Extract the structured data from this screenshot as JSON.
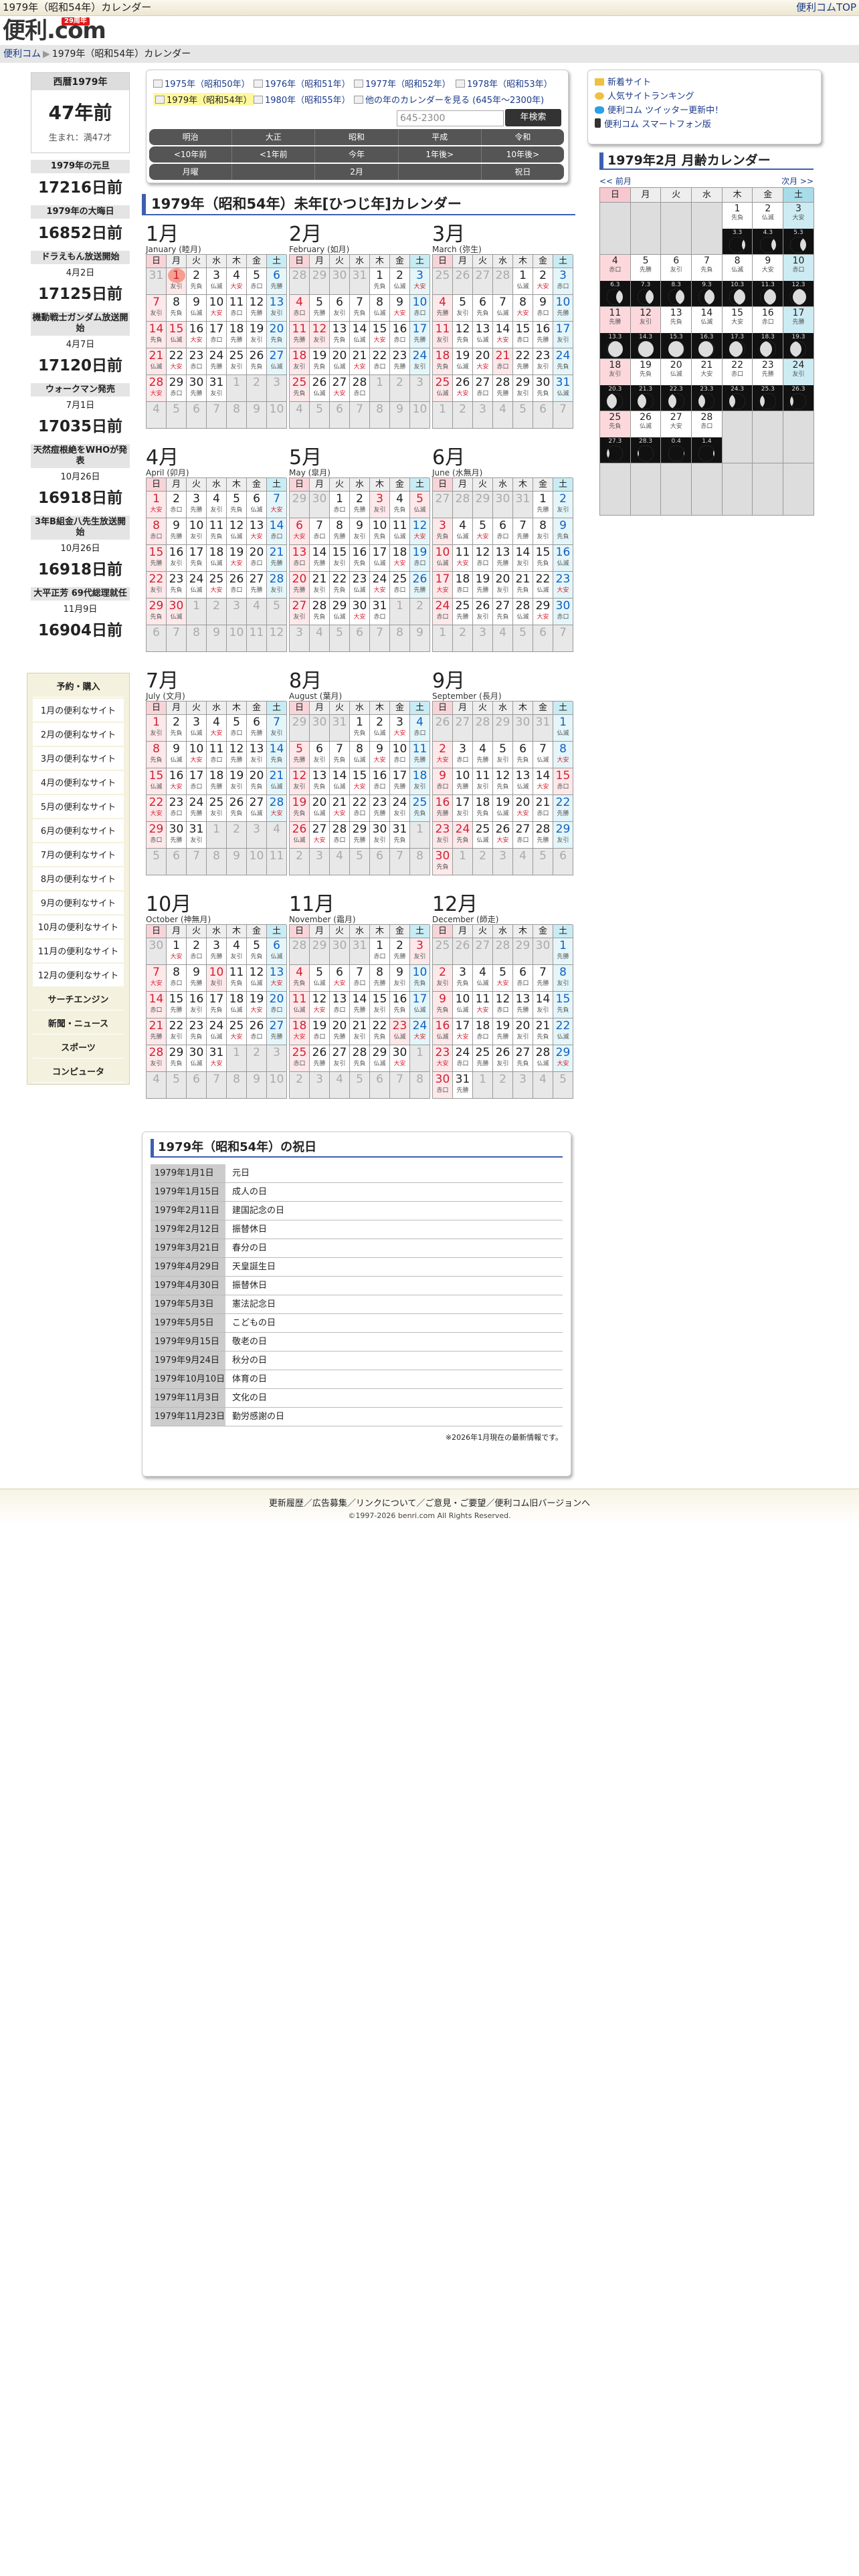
{
  "topbar": {
    "title": "1979年（昭和54年）カレンダー",
    "top_link": "便利コムTOP"
  },
  "logo": {
    "text": "便利.com",
    "badge": "29周年"
  },
  "breadcrumb": {
    "home": "便利コム",
    "sep": "▶",
    "current": "1979年（昭和54年）カレンダー"
  },
  "age": {
    "header": "西暦1979年",
    "big": "47年前",
    "small": "生まれ：満47才"
  },
  "events": [
    {
      "label": "1979年の元旦",
      "date": "",
      "num": "17216日前"
    },
    {
      "label": "1979年の大晦日",
      "date": "",
      "num": "16852日前"
    },
    {
      "label": "ドラえもん放送開始",
      "date": "4月2日",
      "num": "17125日前"
    },
    {
      "label": "機動戦士ガンダム放送開始",
      "date": "4月7日",
      "num": "17120日前"
    },
    {
      "label": "ウォークマン発売",
      "date": "7月1日",
      "num": "17035日前"
    },
    {
      "label": "天然痘根絶をWHOが発表",
      "date": "10月26日",
      "num": "16918日前"
    },
    {
      "label": "3年B組金八先生放送開始",
      "date": "10月26日",
      "num": "16918日前"
    },
    {
      "label": "大平正芳 69代総理就任",
      "date": "11月9日",
      "num": "16904日前"
    }
  ],
  "sidemenu": [
    "予約・購入",
    "1月の便利なサイト",
    "2月の便利なサイト",
    "3月の便利なサイト",
    "4月の便利なサイト",
    "5月の便利なサイト",
    "6月の便利なサイト",
    "7月の便利なサイト",
    "8月の便利なサイト",
    "9月の便利なサイト",
    "10月の便利なサイト",
    "11月の便利なサイト",
    "12月の便利なサイト",
    "サーチエンジン",
    "新聞・ニュース",
    "スポーツ",
    "コンピュータ"
  ],
  "yearlinks": [
    "1975年（昭和50年）",
    "1976年（昭和51年）",
    "1977年（昭和52年）",
    "1978年（昭和53年）",
    "1979年（昭和54年）",
    "1980年（昭和55年）",
    "他の年のカレンダーを見る (645年〜2300年)"
  ],
  "search": {
    "placeholder": "645-2300",
    "button": "年検索"
  },
  "nav1": [
    "明治",
    "大正",
    "昭和",
    "平成",
    "令和"
  ],
  "nav2": [
    "<10年前",
    "<1年前",
    "今年",
    "1年後>",
    "10年後>"
  ],
  "nav3": [
    "月曜",
    "",
    "2月",
    "",
    "祝日"
  ],
  "main_title": "1979年（昭和54年）未年[ひつじ年]カレンダー",
  "weekdays": [
    "日",
    "月",
    "火",
    "水",
    "木",
    "金",
    "土"
  ],
  "months": [
    {
      "title": "1月",
      "sub": "January (睦月)",
      "start": 1,
      "days": 31,
      "hol": [
        1,
        15
      ],
      "today": 1
    },
    {
      "title": "2月",
      "sub": "February (如月)",
      "start": 4,
      "days": 28,
      "hol": [
        11,
        12
      ]
    },
    {
      "title": "3月",
      "sub": "March (弥生)",
      "start": 4,
      "days": 31,
      "hol": [
        21
      ]
    },
    {
      "title": "4月",
      "sub": "April (卯月)",
      "start": 0,
      "days": 30,
      "hol": [
        29,
        30
      ]
    },
    {
      "title": "5月",
      "sub": "May (皐月)",
      "start": 2,
      "days": 31,
      "hol": [
        3,
        5
      ]
    },
    {
      "title": "6月",
      "sub": "June (水無月)",
      "start": 5,
      "days": 30,
      "hol": []
    },
    {
      "title": "7月",
      "sub": "July (文月)",
      "start": 0,
      "days": 31,
      "hol": []
    },
    {
      "title": "8月",
      "sub": "August (葉月)",
      "start": 3,
      "days": 31,
      "hol": []
    },
    {
      "title": "9月",
      "sub": "September (長月)",
      "start": 6,
      "days": 30,
      "hol": [
        15,
        24
      ]
    },
    {
      "title": "10月",
      "sub": "October (神無月)",
      "start": 1,
      "days": 31,
      "hol": [
        10
      ]
    },
    {
      "title": "11月",
      "sub": "November (霜月)",
      "start": 4,
      "days": 30,
      "hol": [
        3,
        23
      ]
    },
    {
      "title": "12月",
      "sub": "December (師走)",
      "start": 6,
      "days": 31,
      "hol": []
    }
  ],
  "rokuyo": [
    "先勝",
    "友引",
    "先負",
    "仏滅",
    "大安",
    "赤口"
  ],
  "links": [
    "新着サイト",
    "人気サイトランキング",
    "便利コム ツイッター更新中！",
    "便利コム スマートフォン版"
  ],
  "right": {
    "title": "1979年2月 月齢カレンダー",
    "prev": "<< 前月",
    "next": "次月 >>",
    "moon_ages": [
      "3.3",
      "4.3",
      "5.3",
      "6.3",
      "7.3",
      "8.3",
      "9.3",
      "10.3",
      "11.3",
      "12.3",
      "13.3",
      "14.3",
      "15.3",
      "16.3",
      "17.3",
      "18.3",
      "19.3",
      "20.3",
      "21.3",
      "22.3",
      "23.3",
      "24.3",
      "25.3",
      "26.3",
      "27.3",
      "28.3",
      "0.4",
      "1.4"
    ]
  },
  "holidays_title": "1979年（昭和54年）の祝日",
  "holidays": [
    [
      "1979年1月1日",
      "元日"
    ],
    [
      "1979年1月15日",
      "成人の日"
    ],
    [
      "1979年2月11日",
      "建国記念の日"
    ],
    [
      "1979年2月12日",
      "振替休日"
    ],
    [
      "1979年3月21日",
      "春分の日"
    ],
    [
      "1979年4月29日",
      "天皇誕生日"
    ],
    [
      "1979年4月30日",
      "振替休日"
    ],
    [
      "1979年5月3日",
      "憲法記念日"
    ],
    [
      "1979年5月5日",
      "こどもの日"
    ],
    [
      "1979年9月15日",
      "敬老の日"
    ],
    [
      "1979年9月24日",
      "秋分の日"
    ],
    [
      "1979年10月10日",
      "体育の日"
    ],
    [
      "1979年11月3日",
      "文化の日"
    ],
    [
      "1979年11月23日",
      "勤労感謝の日"
    ]
  ],
  "holidays_note": "※2026年1月現在の最新情報です。",
  "footer": {
    "links": "更新履歴／広告募集／リンクについて／ご意見・ご要望／便利コム旧バージョンへ",
    "copy": "©1997-2026 benri.com All Rights Reserved."
  }
}
